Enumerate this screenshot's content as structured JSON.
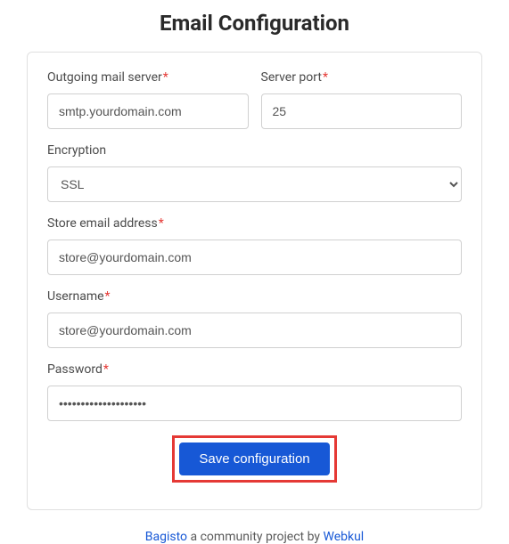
{
  "title": "Email Configuration",
  "fields": {
    "outgoing_server": {
      "label": "Outgoing mail server",
      "required": "*",
      "value": "smtp.yourdomain.com"
    },
    "server_port": {
      "label": "Server port",
      "required": "*",
      "value": "25"
    },
    "encryption": {
      "label": "Encryption",
      "value": "SSL"
    },
    "store_email": {
      "label": "Store email address",
      "required": "*",
      "value": "store@yourdomain.com"
    },
    "username": {
      "label": "Username",
      "required": "*",
      "value": "store@yourdomain.com"
    },
    "password": {
      "label": "Password",
      "required": "*",
      "value": "••••••••••••••••••••"
    }
  },
  "save_button": "Save configuration",
  "footer": {
    "brand": "Bagisto",
    "middle": " a community project by ",
    "company": "Webkul"
  }
}
